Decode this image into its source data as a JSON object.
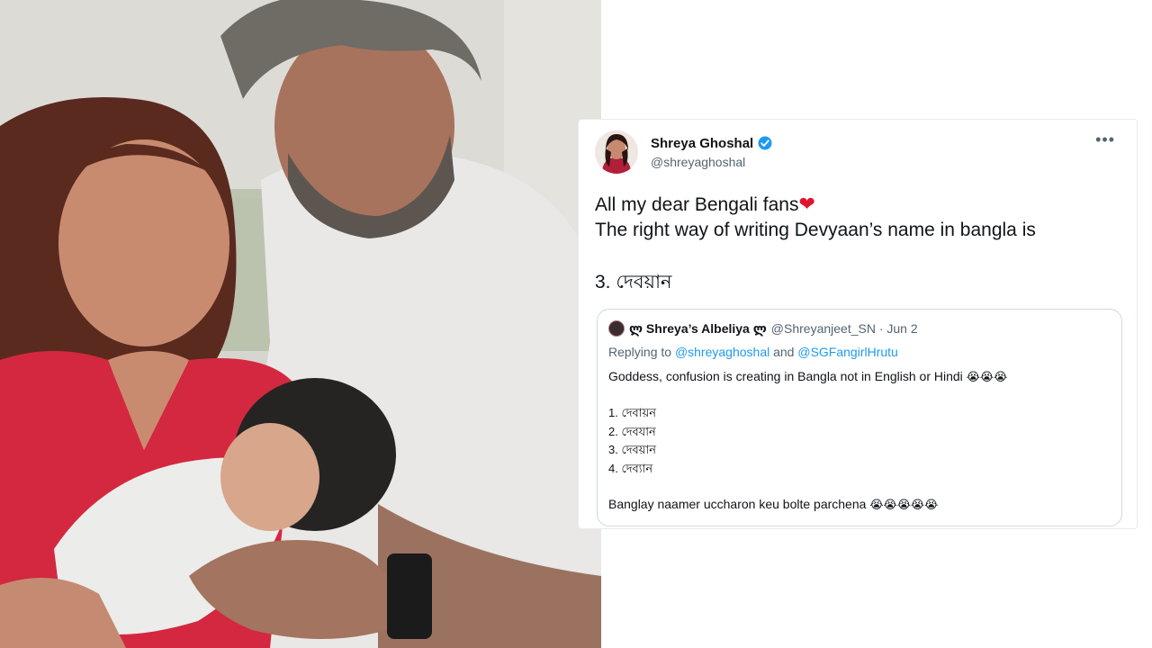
{
  "tweet": {
    "display_name": "Shreya Ghoshal",
    "handle": "@shreyaghoshal",
    "more_icon": "•••",
    "line1": "All my dear Bengali fans",
    "line1_emoji": "❤",
    "line2": "The right way of writing Devyaan’s name in bangla is",
    "line3": "3. দেবয়ান",
    "colors": {
      "text": "#0f1419",
      "secondary": "#536471",
      "link": "#1d9bf0",
      "verified": "#1d9bf0",
      "heart": "#e0142e"
    }
  },
  "quote": {
    "name": "ლ Shreya’s Albeliya ლ",
    "meta": "@Shreyanjeet_SN · Jun 2",
    "replying_prefix": "Replying to",
    "reply_to_1": "@shreyaghoshal",
    "reply_and": "and",
    "reply_to_2": "@SGFangirlHrutu",
    "text": "Goddess, confusion is creating in Bangla not in English or Hindi",
    "text_emoji": "😭😭😭",
    "options": [
      "1. দেবায়ন",
      "2. দেবযান",
      "3. দেবয়ান",
      "4. দেব্যান"
    ],
    "last_line": "Banglay naamer uccharon keu bolte parchena",
    "last_emoji": "😭😭😭😭😭"
  }
}
